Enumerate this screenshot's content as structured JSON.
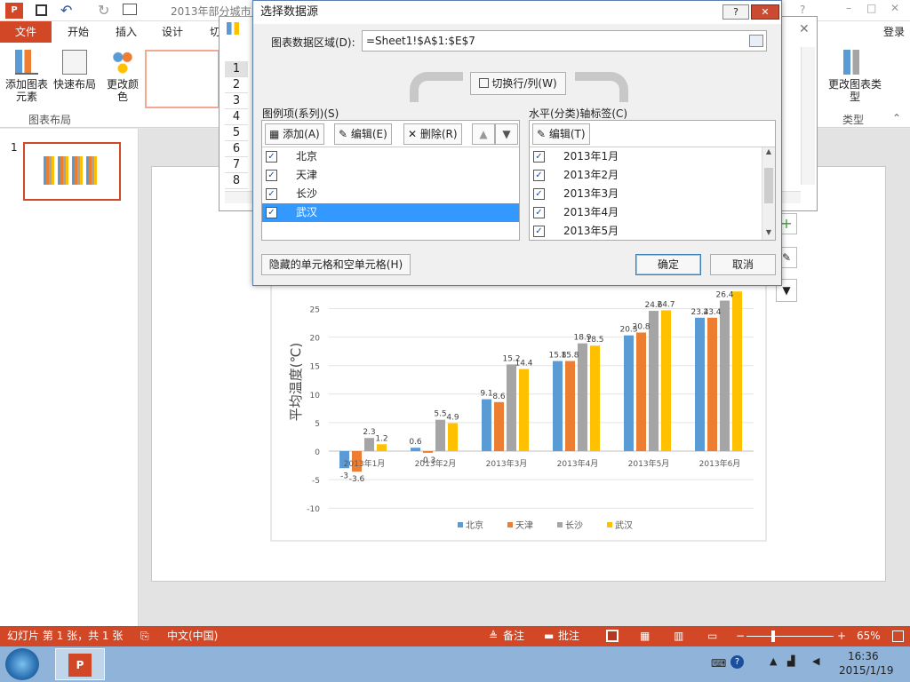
{
  "window": {
    "title": "2013年部分城市",
    "login": "登录"
  },
  "ribbon": {
    "tabs": [
      "文件",
      "开始",
      "插入",
      "设计",
      "切"
    ],
    "add_element": "添加图表元素",
    "quick_layout": "快速布局",
    "change_color": "更改颜色",
    "group_layout": "图表布局",
    "change_type": "更改图表类型",
    "group_type": "类型"
  },
  "sheet": {
    "rows": [
      "1",
      "2",
      "3",
      "4",
      "5",
      "6",
      "7",
      "8"
    ]
  },
  "dialog": {
    "title": "选择数据源",
    "range_label": "图表数据区域(D):",
    "range_value": "=Sheet1!$A$1:$E$7",
    "switch_button": "切换行/列(W)",
    "legend_label": "图例项(系列)(S)",
    "axis_label": "水平(分类)轴标签(C)",
    "add_button": "添加(A)",
    "edit_button": "编辑(E)",
    "delete_button": "删除(R)",
    "axis_edit_button": "编辑(T)",
    "series": [
      {
        "name": "北京",
        "checked": true
      },
      {
        "name": "天津",
        "checked": true
      },
      {
        "name": "长沙",
        "checked": true
      },
      {
        "name": "武汉",
        "checked": true,
        "selected": true
      }
    ],
    "categories": [
      {
        "name": "2013年1月",
        "checked": true
      },
      {
        "name": "2013年2月",
        "checked": true
      },
      {
        "name": "2013年3月",
        "checked": true
      },
      {
        "name": "2013年4月",
        "checked": true
      },
      {
        "name": "2013年5月",
        "checked": true
      }
    ],
    "hidden_cells_button": "隐藏的单元格和空单元格(H)",
    "ok_button": "确定",
    "cancel_button": "取消"
  },
  "slides": {
    "number": "1"
  },
  "status": {
    "slide_info": "幻灯片 第 1 张，共 1 张",
    "language": "中文(中国)",
    "notes": "备注",
    "comments": "批注",
    "zoom": "65%"
  },
  "taskbar": {
    "time": "16:36",
    "date": "2015/1/19"
  },
  "colors": {
    "accent": "#d24726",
    "series": [
      "#5b9bd5",
      "#ed7d31",
      "#a5a5a5",
      "#ffc000"
    ]
  },
  "chart_data": {
    "type": "bar",
    "categories": [
      "2013年1月",
      "2013年2月",
      "2013年3月",
      "2013年4月",
      "2013年5月",
      "2013年6月"
    ],
    "series": [
      {
        "name": "北京",
        "values": [
          -3,
          0.6,
          9.1,
          15.8,
          20.3,
          23.4
        ]
      },
      {
        "name": "天津",
        "values": [
          -3.6,
          -0.3,
          8.6,
          15.8,
          20.8,
          23.4
        ]
      },
      {
        "name": "长沙",
        "values": [
          2.3,
          5.5,
          15.2,
          18.9,
          24.6,
          26.4
        ]
      },
      {
        "name": "武汉",
        "values": [
          1.2,
          4.9,
          14.4,
          18.5,
          24.7,
          28
        ]
      }
    ],
    "labels": [
      [
        "-3",
        "0.6",
        "9.1",
        "15.8",
        "20.3",
        "23.4"
      ],
      [
        "-3.6",
        "-0.3",
        "8.6",
        "15.8",
        "20.8",
        "23.4"
      ],
      [
        "2.3",
        "5.5",
        "15.2",
        "18.9",
        "24.6",
        "26.4"
      ],
      [
        "1.2",
        "4.9",
        "14.4",
        "18.5",
        "24.7",
        ""
      ]
    ],
    "ylabel": "平均温度(℃)",
    "yticks": [
      "25",
      "20",
      "15",
      "10",
      "5",
      "0",
      "-5",
      "-10"
    ],
    "ylim": [
      -10,
      25
    ],
    "legend": "bottom",
    "grid": true
  }
}
